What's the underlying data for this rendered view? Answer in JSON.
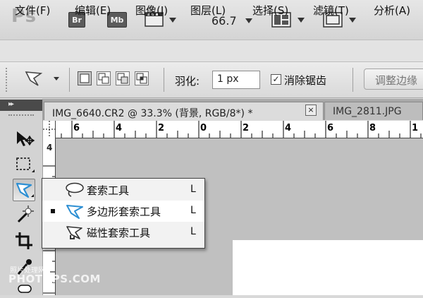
{
  "appbar": {
    "logo": "Ps",
    "bridge_label": "Br",
    "minibridge_label": "Mb",
    "zoom": "66.7"
  },
  "menubar": {
    "items": [
      "文件(F)",
      "编辑(E)",
      "图像(I)",
      "图层(L)",
      "选择(S)",
      "滤镜(T)",
      "分析(A)"
    ]
  },
  "options": {
    "feather_label": "羽化:",
    "feather_value": "1 px",
    "antialias_label": "消除锯齿",
    "antialias_checked": "✓",
    "refine_edge_label": "调整边缘"
  },
  "tabs": [
    {
      "label": "IMG_6640.CR2 @ 33.3% (背景, RGB/8*) *",
      "close": "×"
    },
    {
      "label": "IMG_2811.JPG"
    }
  ],
  "ruler": {
    "h_labels": [
      "6",
      "4",
      "2",
      "0",
      "2",
      "4",
      "6",
      "8",
      "1"
    ],
    "v_labels": [
      "4"
    ]
  },
  "flyout": {
    "items": [
      {
        "label": "套索工具",
        "shortcut": "L",
        "icon": "lasso-icon"
      },
      {
        "label": "多边形套索工具",
        "shortcut": "L",
        "icon": "polygonal-lasso-icon",
        "selected": true
      },
      {
        "label": "磁性套索工具",
        "shortcut": "L",
        "icon": "magnetic-lasso-icon"
      }
    ]
  },
  "watermark": {
    "line1": "照片处理网",
    "line2": "PHOTOPS.COM"
  },
  "colors": {
    "panel_gray": "#d3d3d3",
    "canvas_gray": "#c0c0c0",
    "lasso_blue": "#2d8fd3"
  }
}
